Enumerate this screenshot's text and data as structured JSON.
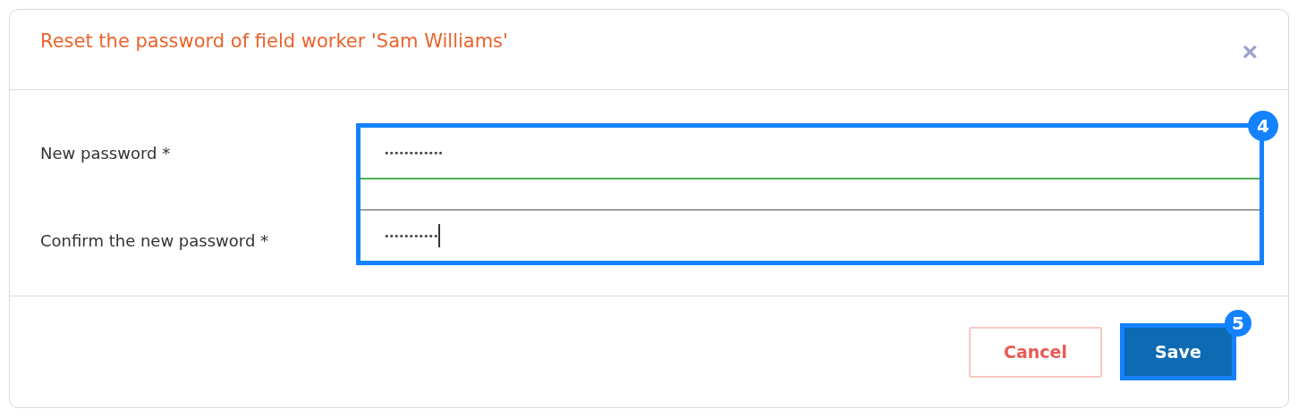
{
  "dialog": {
    "title": "Reset the password of field worker 'Sam Williams'",
    "close": "×"
  },
  "fields": [
    {
      "label": "New password *",
      "value": "••••••••••••",
      "focused": false,
      "valid": true
    },
    {
      "label": "Confirm the new password *",
      "value": "•••••••••••",
      "focused": true,
      "valid": false
    }
  ],
  "fields_highlight": {
    "badge": "4"
  },
  "buttons": [
    {
      "kind": "secondary",
      "label": "Cancel"
    },
    {
      "kind": "primary",
      "label": "Save",
      "badge": "5"
    }
  ]
}
